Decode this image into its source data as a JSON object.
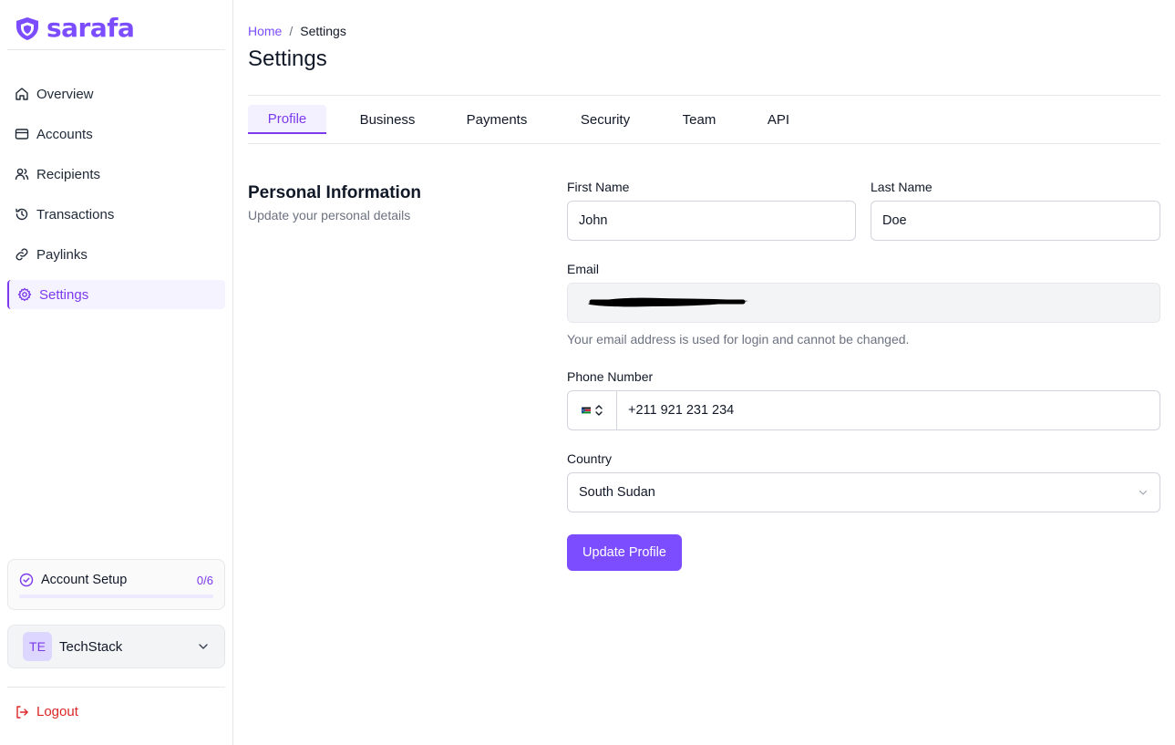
{
  "brand": {
    "name": "sarafa",
    "color": "#7c4dff"
  },
  "sidebar": {
    "items": [
      {
        "label": "Overview",
        "icon": "home-icon"
      },
      {
        "label": "Accounts",
        "icon": "card-icon"
      },
      {
        "label": "Recipients",
        "icon": "users-icon"
      },
      {
        "label": "Transactions",
        "icon": "history-icon"
      },
      {
        "label": "Paylinks",
        "icon": "link-icon"
      },
      {
        "label": "Settings",
        "icon": "gear-icon",
        "active": true
      }
    ],
    "setup": {
      "label": "Account Setup",
      "count": "0/6",
      "progress": 0
    },
    "org": {
      "initials": "TE",
      "name": "TechStack"
    },
    "logout": "Logout"
  },
  "breadcrumb": {
    "home": "Home",
    "separator": "/",
    "current": "Settings"
  },
  "page": {
    "title": "Settings"
  },
  "tabs": [
    "Profile",
    "Business",
    "Payments",
    "Security",
    "Team",
    "API"
  ],
  "active_tab": "Profile",
  "section": {
    "title": "Personal Information",
    "description": "Update your personal details"
  },
  "form": {
    "first_name": {
      "label": "First Name",
      "value": "John"
    },
    "last_name": {
      "label": "Last Name",
      "value": "Doe"
    },
    "email": {
      "label": "Email",
      "value": "",
      "hint": "Your email address is used for login and cannot be changed."
    },
    "phone": {
      "label": "Phone Number",
      "country_flag": "south-sudan-flag",
      "value": "+211 921 231 234"
    },
    "country": {
      "label": "Country",
      "value": "South Sudan"
    },
    "submit": "Update Profile"
  },
  "colors": {
    "accent": "#7c3aed",
    "danger": "#dc2626",
    "active_tab_bg": "#f3f0ff"
  }
}
